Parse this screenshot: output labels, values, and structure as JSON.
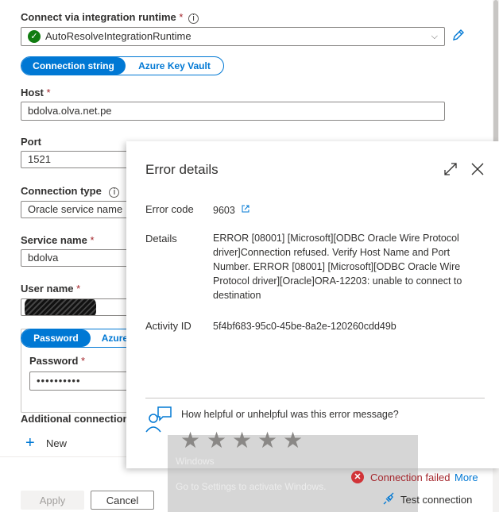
{
  "form": {
    "runtime_label": "Connect via integration runtime",
    "runtime_value": "AutoResolveIntegrationRuntime",
    "toggle1": [
      "Connection string",
      "Azure Key Vault"
    ],
    "host_label": "Host",
    "host_value": "bdolva.olva.net.pe",
    "port_label": "Port",
    "port_value": "1521",
    "conn_type_label": "Connection type",
    "conn_type_value": "Oracle service name",
    "service_label": "Service name",
    "service_value": "bdolva",
    "user_label": "User name",
    "toggle2": [
      "Password",
      "Azure"
    ],
    "password_label": "Password",
    "password_value": "••••••••••",
    "additional_label": "Additional connection",
    "new_label": "New",
    "required_mark": "*"
  },
  "footer": {
    "apply": "Apply",
    "cancel": "Cancel",
    "status": "Connection failed",
    "more": "More",
    "test": "Test connection"
  },
  "error_panel": {
    "title": "Error details",
    "error_code_label": "Error code",
    "error_code": "9603",
    "details_label": "Details",
    "details_lines": [
      "ERROR [08001] [Microsoft][ODBC Oracle Wire Protocol",
      "driver]Connection refused. Verify Host Name and Port",
      "Number. ERROR [08001] [Microsoft][ODBC Oracle Wire",
      "Protocol driver][Oracle]ORA-12203: unable to connect to",
      "destination"
    ],
    "activity_label": "Activity ID",
    "activity_id": "5f4bf683-95c0-45be-8a2e-120260cdd49b",
    "feedback_question": "How helpful or unhelpful was this error message?"
  },
  "overlay_text": {
    "line1": "Windows",
    "line2": "Go to Settings to activate Windows."
  },
  "icons": {
    "success": "check-circle-icon",
    "error": "error-circle-icon"
  },
  "colors": {
    "accent": "#0078d4",
    "success": "#107c10",
    "error": "#a4262c"
  }
}
